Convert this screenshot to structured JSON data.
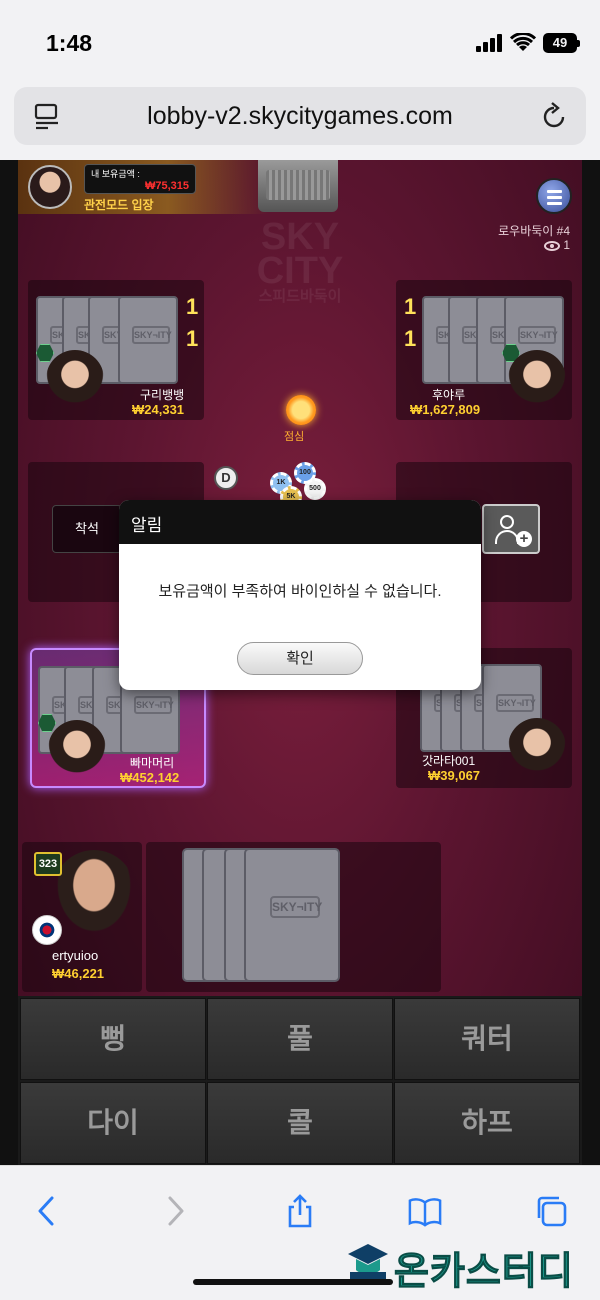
{
  "status_bar": {
    "time": "1:48",
    "battery": "49"
  },
  "browser": {
    "url": "lobby-v2.skycitygames.com"
  },
  "game": {
    "my_balance_label": "내 보유금액 :",
    "my_balance": "₩75,315",
    "spectate_label": "관전모드 입장",
    "watermark_line1": "SKY",
    "watermark_line2": "CITY",
    "watermark_sub": "스피드바둑이",
    "room_name": "로우바둑이 #4",
    "viewer_count": "1",
    "lunch_label": "점심",
    "dealer_label": "D",
    "chips": [
      "100",
      "1K",
      "500",
      "5K"
    ],
    "sit_label": "착석",
    "level": "323",
    "players": [
      {
        "name": "구리뱅뱅",
        "money": "₩24,331",
        "card_counts": [
          "1",
          "1"
        ]
      },
      {
        "name": "후야루",
        "money": "₩1,627,809",
        "card_counts": [
          "1",
          "1"
        ]
      },
      {
        "name": "빠마머리",
        "money": "₩452,142"
      },
      {
        "name": "갓라타001",
        "money": "₩39,067"
      }
    ],
    "me": {
      "name": "ertyuioo",
      "money": "₩46,221"
    },
    "actions": [
      "뻥",
      "풀",
      "쿼터",
      "다이",
      "콜",
      "하프"
    ]
  },
  "modal": {
    "title": "알림",
    "message": "보유금액이 부족하여 바이인하실 수 없습니다.",
    "ok_label": "확인"
  },
  "watermark_brand": "온카스터디",
  "icons": [
    "reader-icon",
    "reload-icon",
    "menu-icon",
    "eye-icon",
    "sun-icon",
    "invite-user-icon",
    "flag-icon",
    "back-icon",
    "forward-icon",
    "share-icon",
    "bookmarks-icon",
    "tabs-icon"
  ]
}
